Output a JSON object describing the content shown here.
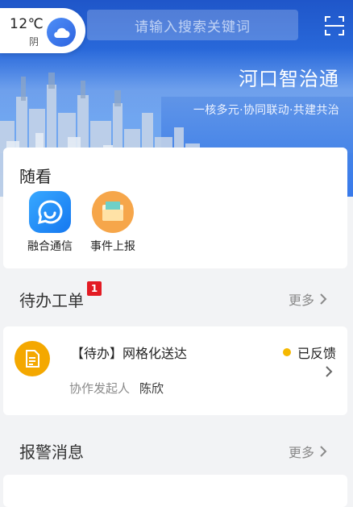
{
  "weather": {
    "temperature": "12℃",
    "condition": "阴",
    "icon": "cloud-icon"
  },
  "search": {
    "placeholder": "请输入搜索关键词",
    "scan_icon": "scan-icon"
  },
  "banner": {
    "title": "河口智治通",
    "slogan": "一核多元·协同联动·共建共治"
  },
  "quick_access": {
    "title": "随看",
    "apps": [
      {
        "label": "融合通信",
        "icon": "chat-bubble-icon"
      },
      {
        "label": "事件上报",
        "icon": "folder-icon"
      }
    ]
  },
  "todo": {
    "title": "待办工单",
    "badge": "1",
    "more": "更多",
    "items": [
      {
        "title": "【待办】网格化送达",
        "status": "已反馈",
        "meta_label": "协作发起人",
        "meta_value": "陈欣",
        "icon": "document-icon"
      }
    ]
  },
  "alarm": {
    "title": "报警消息",
    "more": "更多"
  },
  "colors": {
    "primary": "#2d6ae8",
    "badge": "#e31b23",
    "status_dot": "#f5b800",
    "todo_icon": "#f4a800"
  }
}
